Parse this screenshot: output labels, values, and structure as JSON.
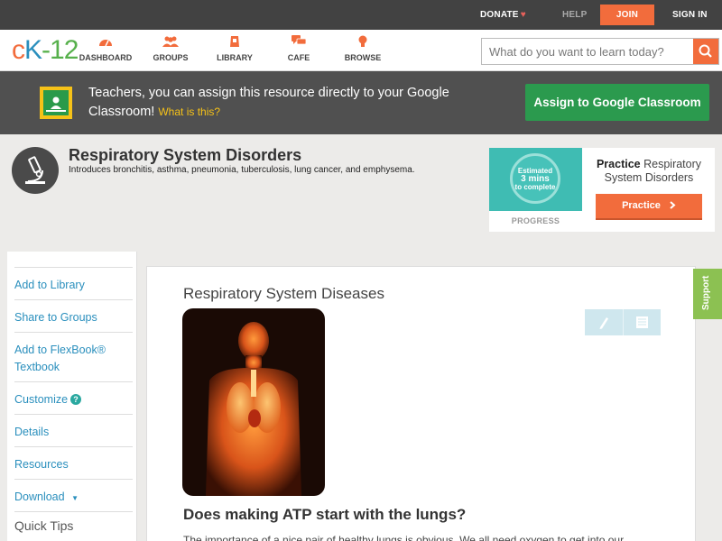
{
  "topbar": {
    "donate": "DONATE",
    "help": "HELP",
    "join": "JOIN",
    "signin": "SIGN IN"
  },
  "nav": {
    "logo": {
      "c": "c",
      "k": "K",
      "dash": "-",
      "num": "12"
    },
    "items": [
      {
        "label": "DASHBOARD",
        "icon": "dashboard-icon"
      },
      {
        "label": "GROUPS",
        "icon": "groups-icon"
      },
      {
        "label": "LIBRARY",
        "icon": "library-icon"
      },
      {
        "label": "CAFE",
        "icon": "cafe-icon"
      },
      {
        "label": "BROWSE",
        "icon": "browse-icon"
      }
    ],
    "search_placeholder": "What do you want to learn today?"
  },
  "classroom_banner": {
    "text": "Teachers, you can assign this resource directly to your Google Classroom!",
    "what": "What is this?",
    "button": "Assign to Google Classroom"
  },
  "page": {
    "title": "Respiratory System Disorders",
    "subtitle": "Introduces bronchitis, asthma, pneumonia, tuberculosis, lung cancer, and emphysema."
  },
  "practice": {
    "estimated_line1": "Estimated",
    "estimated_line2": "3 mins",
    "estimated_line3": "to complete",
    "progress_label": "PROGRESS",
    "title_bold": "Practice",
    "title_rest": "Respiratory System Disorders",
    "button": "Practice"
  },
  "sidebar": {
    "items": [
      "Add to Library",
      "Share to Groups",
      "Add to FlexBook® Textbook",
      "Customize",
      "Details",
      "Resources",
      "Download"
    ],
    "quick_tips": "Quick Tips"
  },
  "content": {
    "heading": "Respiratory System Diseases",
    "question": "Does making ATP start with the lungs?",
    "paragraph": "The importance of a nice pair of healthy lungs is obvious. We all need oxygen to get into our"
  },
  "support": "Support",
  "colors": {
    "accent": "#f26c3c",
    "link": "#2a8fbd",
    "classroom_green": "#2b9a4e"
  }
}
